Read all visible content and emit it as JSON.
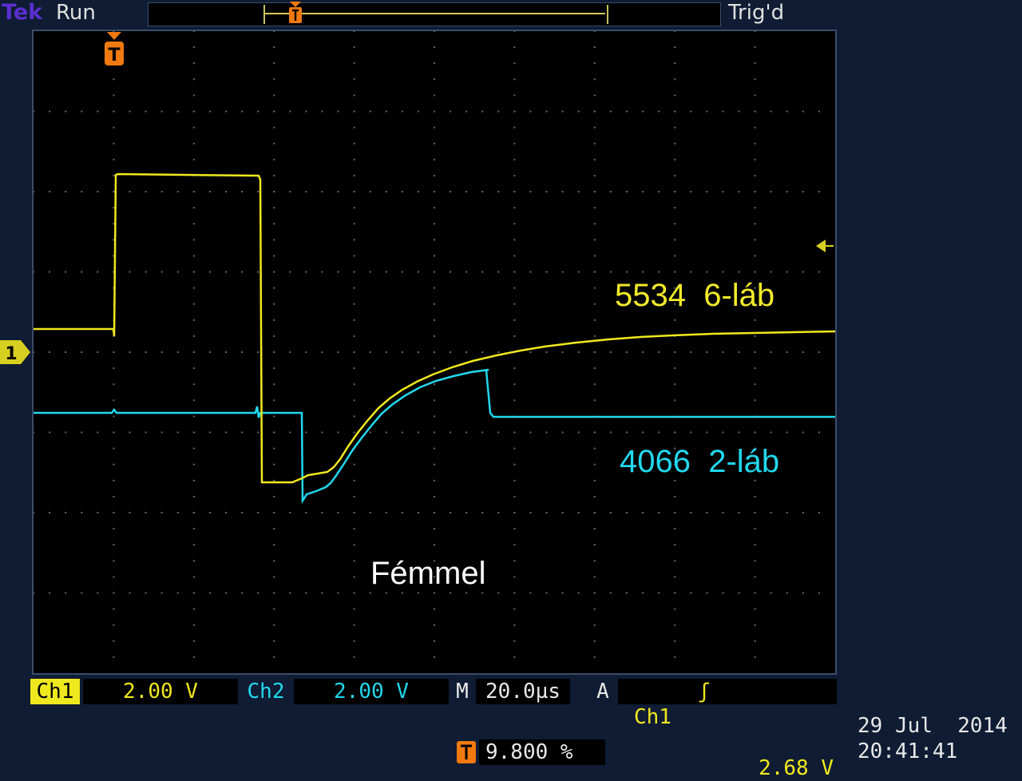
{
  "header": {
    "brand": "Tek",
    "acquisition_state": "Run",
    "trigger_status": "Trig'd"
  },
  "screen": {
    "ch1_label": "5534  6-láb",
    "ch2_label": "4066  2-láb",
    "annotation": "Fémmel",
    "ch1_ground_marker": "1",
    "trigger_marker": "T"
  },
  "readout": {
    "ch1_tag": "Ch1",
    "ch1_scale": "2.00 V",
    "ch2_tag": "Ch2",
    "ch2_scale": "2.00 V",
    "timebase_tag": "M",
    "timebase": "20.0µs",
    "trigger_mode_tag": "A",
    "trigger_source": "Ch1",
    "trigger_slope": "ʃ",
    "trigger_level": "2.68 V",
    "trigger_position": "9.800 %",
    "date": "29 Jul  2014",
    "time": "20:41:41"
  },
  "colors": {
    "ch1": "#f0e81e",
    "ch2": "#22d8ee",
    "trigger": "#f07a10",
    "background": "#0f1c33"
  }
}
